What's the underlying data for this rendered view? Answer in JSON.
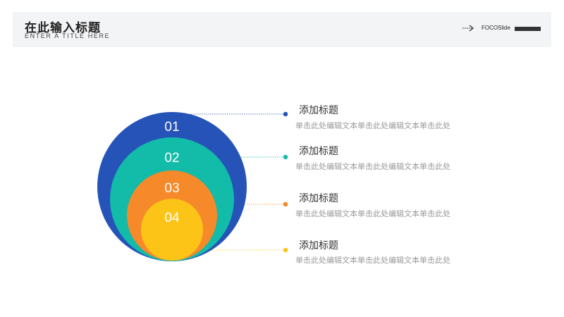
{
  "header": {
    "title": "在此输入标题",
    "subtitle": "ENTER A TITLE HERE",
    "brand": "FOCOSlide",
    "arrow_icon": "dotted-arrow-icon"
  },
  "circles": [
    {
      "label": "01",
      "color": "#2553b8"
    },
    {
      "label": "02",
      "color": "#13bba9"
    },
    {
      "label": "03",
      "color": "#f6892a"
    },
    {
      "label": "04",
      "color": "#fdc418"
    }
  ],
  "items": [
    {
      "title": "添加标题",
      "desc": "单击此处编辑文本单击此处编辑文本单击此处",
      "color": "#2553b8"
    },
    {
      "title": "添加标题",
      "desc": "单击此处编辑文本单击此处编辑文本单击此处",
      "color": "#13bba9"
    },
    {
      "title": "添加标题",
      "desc": "单击此处编辑文本单击此处编辑文本单击此处",
      "color": "#f6892a"
    },
    {
      "title": "添加标题",
      "desc": "单击此处编辑文本单击此处编辑文本单击此处",
      "color": "#fdc418"
    }
  ]
}
